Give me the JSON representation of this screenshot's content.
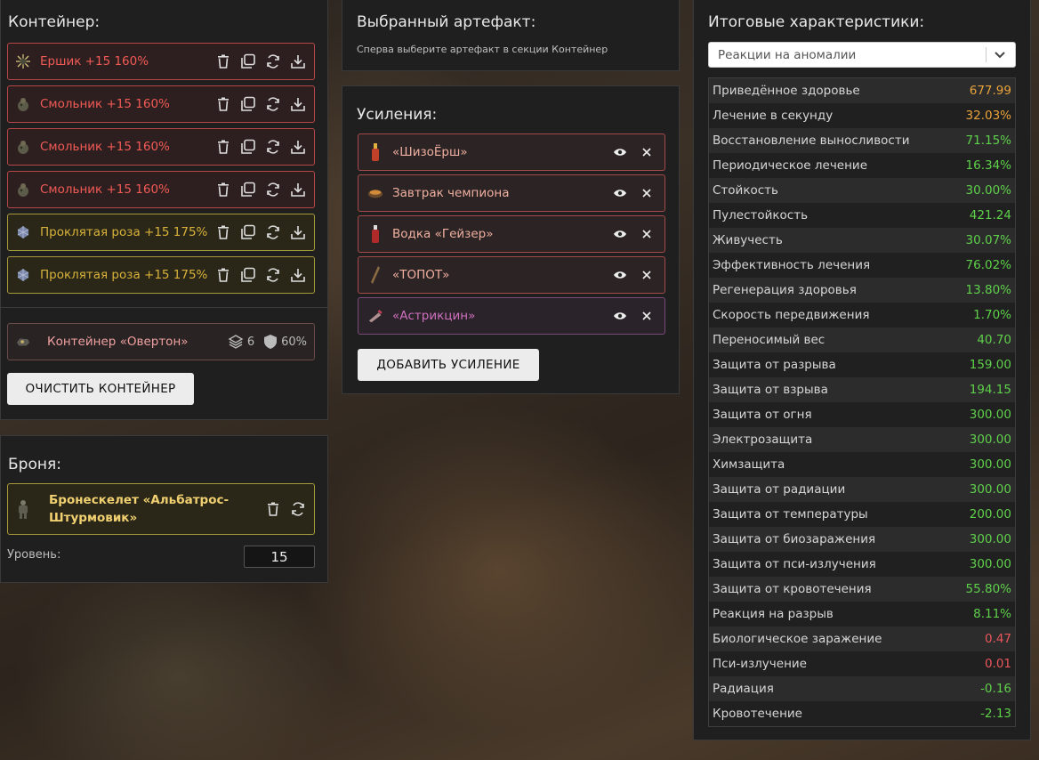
{
  "container": {
    "title": "Контейнер:",
    "artifacts": [
      {
        "name": "Ершик +15 160%",
        "color": "red",
        "icon": "urchin-artifact-icon"
      },
      {
        "name": "Смольник +15 160%",
        "color": "red",
        "icon": "tar-artifact-icon"
      },
      {
        "name": "Смольник +15 160%",
        "color": "red",
        "icon": "tar-artifact-icon"
      },
      {
        "name": "Смольник +15 160%",
        "color": "red",
        "icon": "tar-artifact-icon"
      },
      {
        "name": "Проклятая роза +15 175%",
        "color": "yellow",
        "icon": "rose-artifact-icon"
      },
      {
        "name": "Проклятая роза +15 175%",
        "color": "yellow",
        "icon": "rose-artifact-icon"
      }
    ],
    "box": {
      "name": "Контейнер «Овертон»",
      "slots": "6",
      "protection": "60%"
    },
    "clear_label": "ОЧИСТИТЬ КОНТЕЙНЕР"
  },
  "armor": {
    "title": "Броня:",
    "name_line1": "Бронескелет «Альбатрос-",
    "name_line2": "Штурмовик»",
    "level_label": "Уровень:",
    "level_value": "15"
  },
  "selected": {
    "title": "Выбранный артефакт:",
    "hint": "Сперва выберите артефакт в секции Контейнер"
  },
  "boosts": {
    "title": "Усиления:",
    "items": [
      {
        "name": "«ШизоЁрш»",
        "color": "red"
      },
      {
        "name": "Завтрак чемпиона",
        "color": "red"
      },
      {
        "name": "Водка «Гейзер»",
        "color": "red"
      },
      {
        "name": "«ТОПОТ»",
        "color": "red"
      },
      {
        "name": "«Астрикцин»",
        "color": "purple"
      }
    ],
    "add_label": "ДОБАВИТЬ УСИЛЕНИЕ"
  },
  "totals": {
    "title": "Итоговые характеристики:",
    "select_value": "Реакции на аномалии",
    "stats": [
      {
        "label": "Приведённое здоровье",
        "value": "677.99",
        "color": "orange"
      },
      {
        "label": "Лечение в секунду",
        "value": "32.03%",
        "color": "orange"
      },
      {
        "label": "Восстановление выносливости",
        "value": "71.15%",
        "color": "green"
      },
      {
        "label": "Периодическое лечение",
        "value": "16.34%",
        "color": "green"
      },
      {
        "label": "Стойкость",
        "value": "30.00%",
        "color": "green"
      },
      {
        "label": "Пулестойкость",
        "value": "421.24",
        "color": "green"
      },
      {
        "label": "Живучесть",
        "value": "30.07%",
        "color": "green"
      },
      {
        "label": "Эффективность лечения",
        "value": "76.02%",
        "color": "green"
      },
      {
        "label": "Регенерация здоровья",
        "value": "13.80%",
        "color": "green"
      },
      {
        "label": "Скорость передвижения",
        "value": "1.70%",
        "color": "green"
      },
      {
        "label": "Переносимый вес",
        "value": "40.70",
        "color": "green"
      },
      {
        "label": "Защита от разрыва",
        "value": "159.00",
        "color": "green"
      },
      {
        "label": "Защита от взрыва",
        "value": "194.15",
        "color": "green"
      },
      {
        "label": "Защита от огня",
        "value": "300.00",
        "color": "green"
      },
      {
        "label": "Электрозащита",
        "value": "300.00",
        "color": "green"
      },
      {
        "label": "Химзащита",
        "value": "300.00",
        "color": "green"
      },
      {
        "label": "Защита от радиации",
        "value": "300.00",
        "color": "green"
      },
      {
        "label": "Защита от температуры",
        "value": "200.00",
        "color": "green"
      },
      {
        "label": "Защита от биозаражения",
        "value": "300.00",
        "color": "green"
      },
      {
        "label": "Защита от пси-излучения",
        "value": "300.00",
        "color": "green"
      },
      {
        "label": "Защита от кровотечения",
        "value": "55.80%",
        "color": "green"
      },
      {
        "label": "Реакция на разрыв",
        "value": "8.11%",
        "color": "green"
      },
      {
        "label": "Биологическое заражение",
        "value": "0.47",
        "color": "red"
      },
      {
        "label": "Пси-излучение",
        "value": "0.01",
        "color": "red"
      },
      {
        "label": "Радиация",
        "value": "-0.16",
        "color": "green"
      },
      {
        "label": "Кровотечение",
        "value": "-2.13",
        "color": "green"
      }
    ]
  }
}
